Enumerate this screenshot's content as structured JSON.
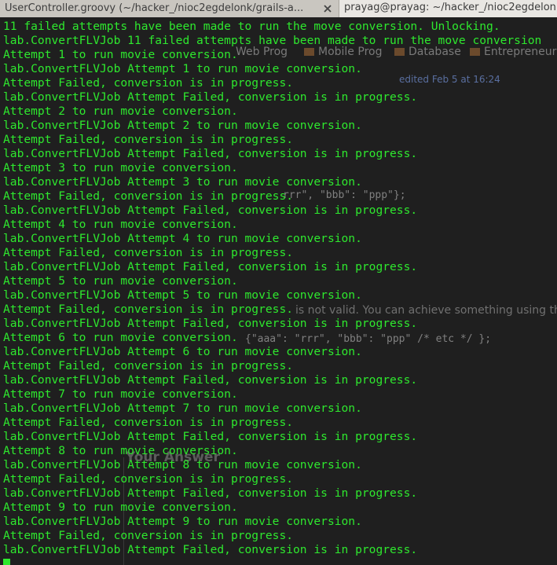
{
  "tabs": [
    {
      "title": "UserController.groovy (~/hacker_/nioc2egdelonk/grails-a..."
    },
    {
      "title": "prayag@prayag: ~/hacker_/nioc2egdelonk/grails-a"
    }
  ],
  "colors": {
    "terminal_text": "#2ee82e",
    "terminal_bg": "#1f1f1f"
  },
  "background_page": {
    "bookmarks": [
      "Web Prog",
      "Mobile Prog",
      "Database",
      "Entrepreneur"
    ],
    "edited": "edited Feb 5 at 16:24",
    "code1": "rrr\", \"bbb\": \"ppp\"};",
    "paragraph": "is not valid. You can achieve something using the",
    "code2": "{\"aaa\": \"rrr\", \"bbb\": \"ppp\" /* etc */ };",
    "your_answer": "Your Answer"
  },
  "terminal": {
    "lines": [
      "11 failed attempts have been made to run the move conversion. Unlocking.",
      "lab.ConvertFLVJob 11 failed attempts have been made to run the move conversion",
      "Attempt 1 to run movie conversion.",
      "lab.ConvertFLVJob Attempt 1 to run movie conversion.",
      "Attempt Failed, conversion is in progress.",
      "lab.ConvertFLVJob Attempt Failed, conversion is in progress.",
      "Attempt 2 to run movie conversion.",
      "lab.ConvertFLVJob Attempt 2 to run movie conversion.",
      "Attempt Failed, conversion is in progress.",
      "lab.ConvertFLVJob Attempt Failed, conversion is in progress.",
      "Attempt 3 to run movie conversion.",
      "lab.ConvertFLVJob Attempt 3 to run movie conversion.",
      "Attempt Failed, conversion is in progress.",
      "lab.ConvertFLVJob Attempt Failed, conversion is in progress.",
      "Attempt 4 to run movie conversion.",
      "lab.ConvertFLVJob Attempt 4 to run movie conversion.",
      "Attempt Failed, conversion is in progress.",
      "lab.ConvertFLVJob Attempt Failed, conversion is in progress.",
      "Attempt 5 to run movie conversion.",
      "lab.ConvertFLVJob Attempt 5 to run movie conversion.",
      "Attempt Failed, conversion is in progress.",
      "lab.ConvertFLVJob Attempt Failed, conversion is in progress.",
      "Attempt 6 to run movie conversion.",
      "lab.ConvertFLVJob Attempt 6 to run movie conversion.",
      "Attempt Failed, conversion is in progress.",
      "lab.ConvertFLVJob Attempt Failed, conversion is in progress.",
      "Attempt 7 to run movie conversion.",
      "lab.ConvertFLVJob Attempt 7 to run movie conversion.",
      "Attempt Failed, conversion is in progress.",
      "lab.ConvertFLVJob Attempt Failed, conversion is in progress.",
      "Attempt 8 to run movie conversion.",
      "lab.ConvertFLVJob Attempt 8 to run movie conversion.",
      "Attempt Failed, conversion is in progress.",
      "lab.ConvertFLVJob Attempt Failed, conversion is in progress.",
      "Attempt 9 to run movie conversion.",
      "lab.ConvertFLVJob Attempt 9 to run movie conversion.",
      "Attempt Failed, conversion is in progress.",
      "lab.ConvertFLVJob Attempt Failed, conversion is in progress."
    ]
  }
}
